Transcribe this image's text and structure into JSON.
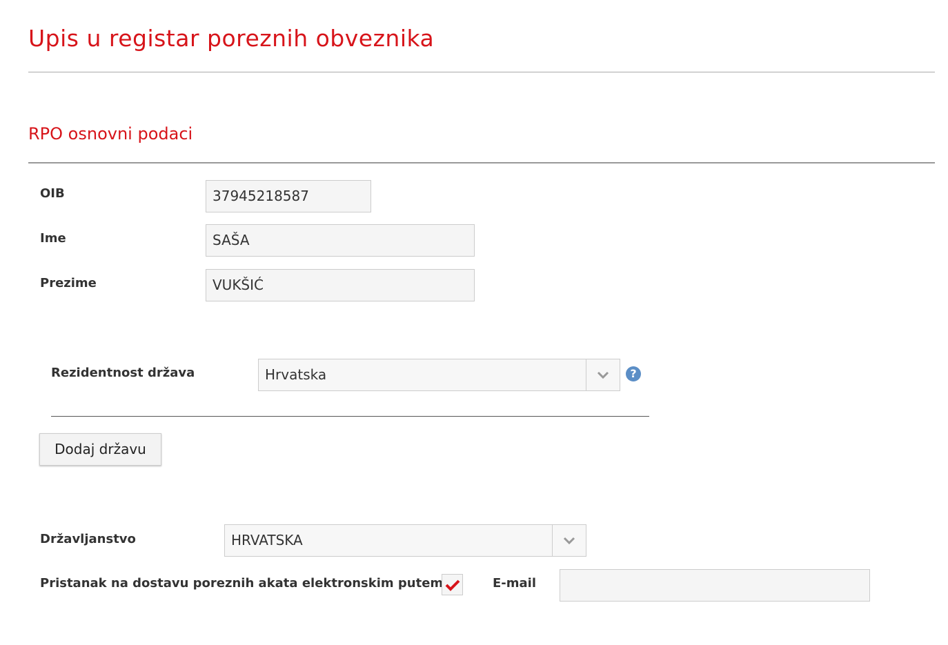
{
  "page": {
    "title": "Upis u registar poreznih obveznika",
    "section_title": "RPO osnovni podaci"
  },
  "colors": {
    "accent": "#d7141a",
    "help_icon": "#5b8ec6"
  },
  "fields": {
    "oib": {
      "label": "OIB",
      "value": "37945218587"
    },
    "ime": {
      "label": "Ime",
      "value": "SAŠA"
    },
    "prezime": {
      "label": "Prezime",
      "value": "VUKŠIĆ"
    }
  },
  "residency": {
    "label": "Rezidentnost država",
    "value": "Hrvatska",
    "icon": "chevron-down-icon",
    "help_icon": "question-circle-icon",
    "help_symbol": "?"
  },
  "add_country_button": "Dodaj državu",
  "citizenship": {
    "label": "Državljanstvo",
    "value": "HRVATSKA",
    "icon": "chevron-down-icon"
  },
  "consent": {
    "label": "Pristanak na dostavu poreznih akata elektronskim putem",
    "checked": true,
    "icon": "checkmark-icon"
  },
  "email": {
    "label": "E-mail",
    "value": ""
  }
}
